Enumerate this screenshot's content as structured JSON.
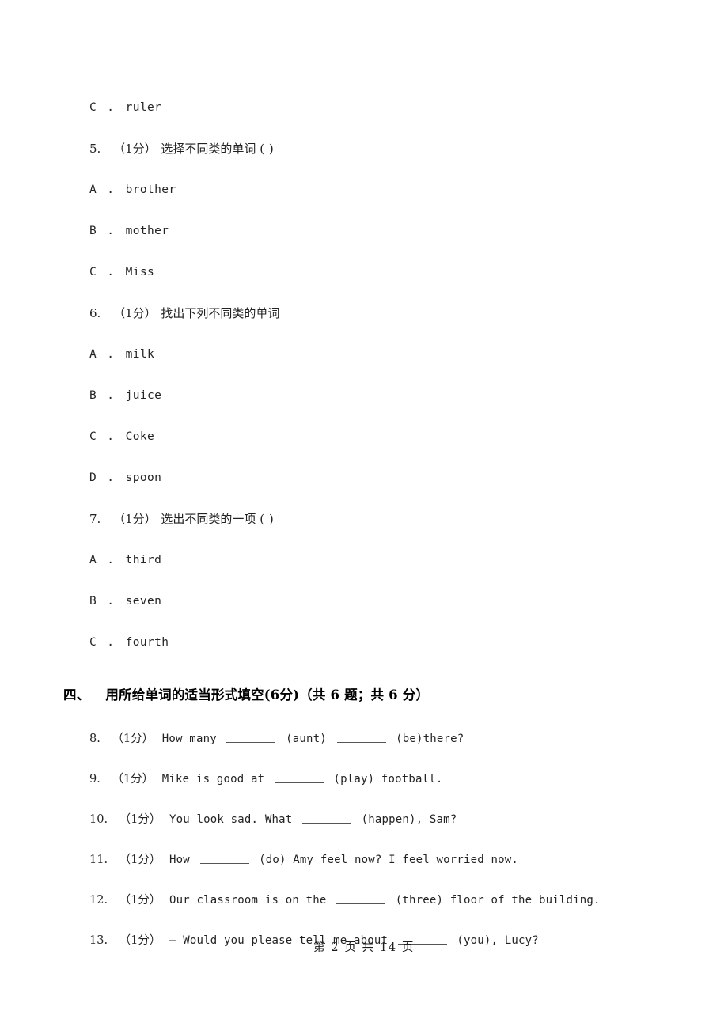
{
  "document": {
    "type": "exam-paper",
    "footer": "第 2 页 共 14 页",
    "background_color": "#ffffff",
    "text_color": "#222222"
  },
  "orphan_option": {
    "letter": "C",
    "dot": ".",
    "text": "ruler"
  },
  "multiple_choice": [
    {
      "number": "5.",
      "score": "（1分）",
      "stem": "选择不同类的单词",
      "answer_paren": "(        )",
      "options": [
        {
          "letter": "A",
          "dot": ".",
          "text": "brother"
        },
        {
          "letter": "B",
          "dot": ".",
          "text": "mother"
        },
        {
          "letter": "C",
          "dot": ".",
          "text": "Miss"
        }
      ]
    },
    {
      "number": "6.",
      "score": "（1分）",
      "stem": "找出下列不同类的单词",
      "answer_paren": "",
      "options": [
        {
          "letter": "A",
          "dot": ".",
          "text": "milk"
        },
        {
          "letter": "B",
          "dot": ".",
          "text": "juice"
        },
        {
          "letter": "C",
          "dot": ".",
          "text": "Coke"
        },
        {
          "letter": "D",
          "dot": ".",
          "text": "spoon"
        }
      ]
    },
    {
      "number": "7.",
      "score": "（1分）",
      "stem": "选出不同类的一项",
      "answer_paren": "(       )",
      "options": [
        {
          "letter": "A",
          "dot": ".",
          "text": "third"
        },
        {
          "letter": "B",
          "dot": ".",
          "text": "seven"
        },
        {
          "letter": "C",
          "dot": ".",
          "text": "fourth"
        }
      ]
    }
  ],
  "section_four": {
    "number": "四、",
    "title": "用所给单词的适当形式填空(6分)（共 6 题；共 6 分）",
    "questions": [
      {
        "number": "8.",
        "score": "（1分）",
        "parts": [
          "How many ",
          "BLANK",
          " (aunt) ",
          "BLANK",
          " (be)there?"
        ],
        "plain": "How many ______ (aunt) ______ (be)there?"
      },
      {
        "number": "9.",
        "score": "（1分）",
        "parts": [
          "Mike is good at ",
          "BLANK",
          " (play) football."
        ],
        "plain": "Mike is good at ______ (play) football."
      },
      {
        "number": "10.",
        "score": "（1分）",
        "parts": [
          "You look sad. What ",
          "BLANK",
          "  (happen), Sam?"
        ],
        "plain": "You look sad. What ______  (happen), Sam?"
      },
      {
        "number": "11.",
        "score": "（1分）",
        "parts": [
          "How ",
          "BLANK",
          "  (do) Amy feel now? I feel worried now."
        ],
        "plain": "How ______  (do) Amy feel now? I feel worried now."
      },
      {
        "number": "12.",
        "score": "（1分）",
        "parts": [
          "Our classroom is on the ",
          "BLANK",
          " (three) floor of the building."
        ],
        "plain": "Our classroom is on the ______ (three) floor of the building."
      },
      {
        "number": "13.",
        "score": "（1分）",
        "parts": [
          "— Would you please tell me about ",
          "BLANK",
          " (you), Lucy?"
        ],
        "plain": "— Would you please tell me about ______ (you), Lucy?"
      }
    ]
  }
}
